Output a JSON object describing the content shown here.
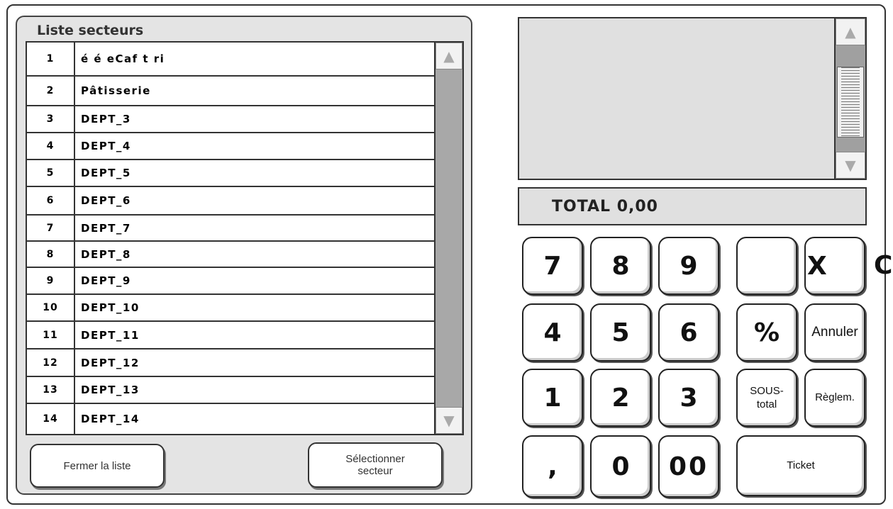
{
  "sector_panel": {
    "title": "Liste secteurs",
    "rows": [
      {
        "num": "1",
        "name": "é é eCaf t ri"
      },
      {
        "num": "2",
        "name": "Pâtisserie"
      },
      {
        "num": "3",
        "name": "DEPT_3"
      },
      {
        "num": "4",
        "name": "DEPT_4"
      },
      {
        "num": "5",
        "name": "DEPT_5"
      },
      {
        "num": "6",
        "name": "DEPT_6"
      },
      {
        "num": "7",
        "name": "DEPT_7"
      },
      {
        "num": "8",
        "name": "DEPT_8"
      },
      {
        "num": "9",
        "name": "DEPT_9"
      },
      {
        "num": "10",
        "name": "DEPT_10"
      },
      {
        "num": "11",
        "name": "DEPT_11"
      },
      {
        "num": "12",
        "name": "DEPT_12"
      },
      {
        "num": "13",
        "name": "DEPT_13"
      },
      {
        "num": "14",
        "name": "DEPT_14"
      }
    ],
    "close_label": "Fermer la liste",
    "select_label_1": "Sélectionner",
    "select_label_2": "secteur",
    "scroll_up_icon": "triangle-up-icon",
    "scroll_down_icon": "triangle-down-icon"
  },
  "display": {
    "total_text": "TOTAL 0,00"
  },
  "keypad": {
    "k7": "7",
    "k8": "8",
    "k9": "9",
    "blank": "",
    "x": "X",
    "c": "C",
    "k4": "4",
    "k5": "5",
    "k6": "6",
    "percent": "%",
    "cancel": "Annuler",
    "k1": "1",
    "k2": "2",
    "k3": "3",
    "subtotal_1": "SOUS-",
    "subtotal_2": "total",
    "settle": "Règlem.",
    "comma": ",",
    "k0": "0",
    "k00": "00",
    "ticket": "Ticket"
  },
  "colors": {
    "panel_bg": "#e4e4e4",
    "scrollbar": "#a8a8a8",
    "display_bg": "#e0e0e0"
  }
}
